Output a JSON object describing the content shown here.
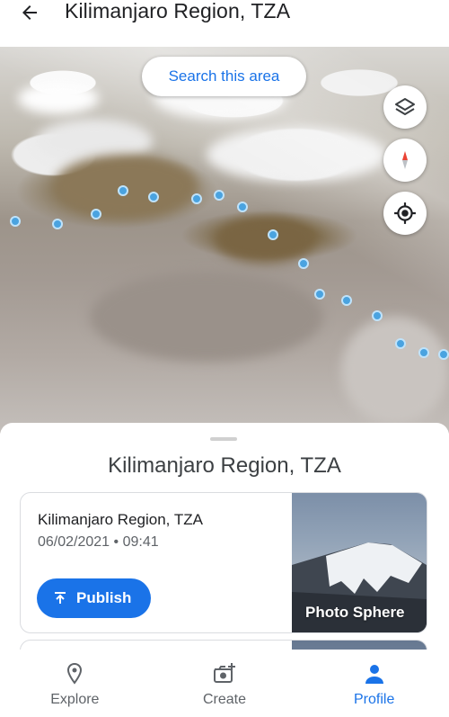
{
  "header": {
    "title": "Kilimanjaro Region, TZA",
    "back_icon": "arrow-back-icon"
  },
  "map": {
    "search_area_label": "Search this area",
    "controls": [
      "layers-icon",
      "compass-icon",
      "my-location-icon"
    ]
  },
  "sheet": {
    "title": "Kilimanjaro Region, TZA",
    "cards": [
      {
        "title": "Kilimanjaro Region, TZA",
        "date": "06/02/2021",
        "separator": "•",
        "time": "09:41",
        "publish_label": "Publish",
        "thumb_label": "Photo Sphere"
      }
    ]
  },
  "bottom_nav": {
    "items": [
      {
        "label": "Explore",
        "icon": "location-pin-icon",
        "active": false
      },
      {
        "label": "Create",
        "icon": "add-photo-icon",
        "active": false
      },
      {
        "label": "Profile",
        "icon": "person-icon",
        "active": true
      }
    ]
  },
  "colors": {
    "accent": "#1a73e8",
    "route_dot": "#4aa3e0",
    "compass_red": "#ea4335"
  }
}
